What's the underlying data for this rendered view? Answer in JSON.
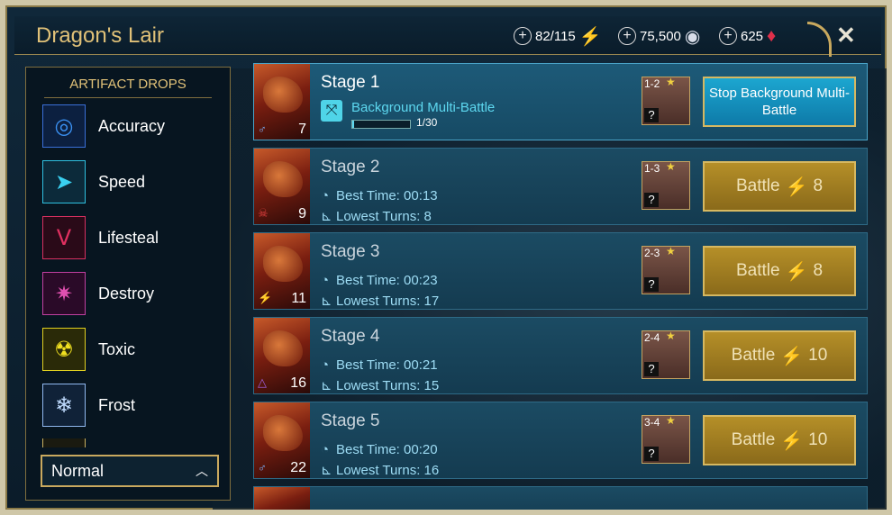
{
  "header": {
    "title": "Dragon's Lair",
    "energy": "82/115",
    "silver": "75,500",
    "gems": "625",
    "close": "✕"
  },
  "sidebar": {
    "title": "ARTIFACT DROPS",
    "items": [
      {
        "label": "Accuracy",
        "icon": "accuracy-icon",
        "color": "#3a6fd8",
        "glyph": "◎"
      },
      {
        "label": "Speed",
        "icon": "speed-icon",
        "color": "#2fc0e0",
        "glyph": "➤"
      },
      {
        "label": "Lifesteal",
        "icon": "lifesteal-icon",
        "color": "#d83060",
        "glyph": "ᐯ"
      },
      {
        "label": "Destroy",
        "icon": "destroy-icon",
        "color": "#c040a0",
        "glyph": "✷"
      },
      {
        "label": "Toxic",
        "icon": "toxic-icon",
        "color": "#e0d020",
        "glyph": "☢"
      },
      {
        "label": "Frost",
        "icon": "frost-icon",
        "color": "#90b8f0",
        "glyph": "❄"
      }
    ],
    "difficulty": "Normal"
  },
  "stages": [
    {
      "name": "Stage 1",
      "level": "7",
      "chest_range": "1-2",
      "multi_battle": "Background Multi-Battle",
      "progress_text": "1/30",
      "progress": 0.03,
      "button": "Stop Background Multi-Battle"
    },
    {
      "name": "Stage 2",
      "level": "9",
      "chest_range": "1-3",
      "best_time": "Best Time: 00:13",
      "lowest_turns": "Lowest Turns: 8",
      "button": "Battle",
      "energy": "8"
    },
    {
      "name": "Stage 3",
      "level": "11",
      "chest_range": "2-3",
      "best_time": "Best Time: 00:23",
      "lowest_turns": "Lowest Turns: 17",
      "button": "Battle",
      "energy": "8"
    },
    {
      "name": "Stage 4",
      "level": "16",
      "chest_range": "2-4",
      "best_time": "Best Time: 00:21",
      "lowest_turns": "Lowest Turns: 15",
      "button": "Battle",
      "energy": "10"
    },
    {
      "name": "Stage 5",
      "level": "22",
      "chest_range": "3-4",
      "best_time": "Best Time: 00:20",
      "lowest_turns": "Lowest Turns: 16",
      "button": "Battle",
      "energy": "10"
    }
  ]
}
